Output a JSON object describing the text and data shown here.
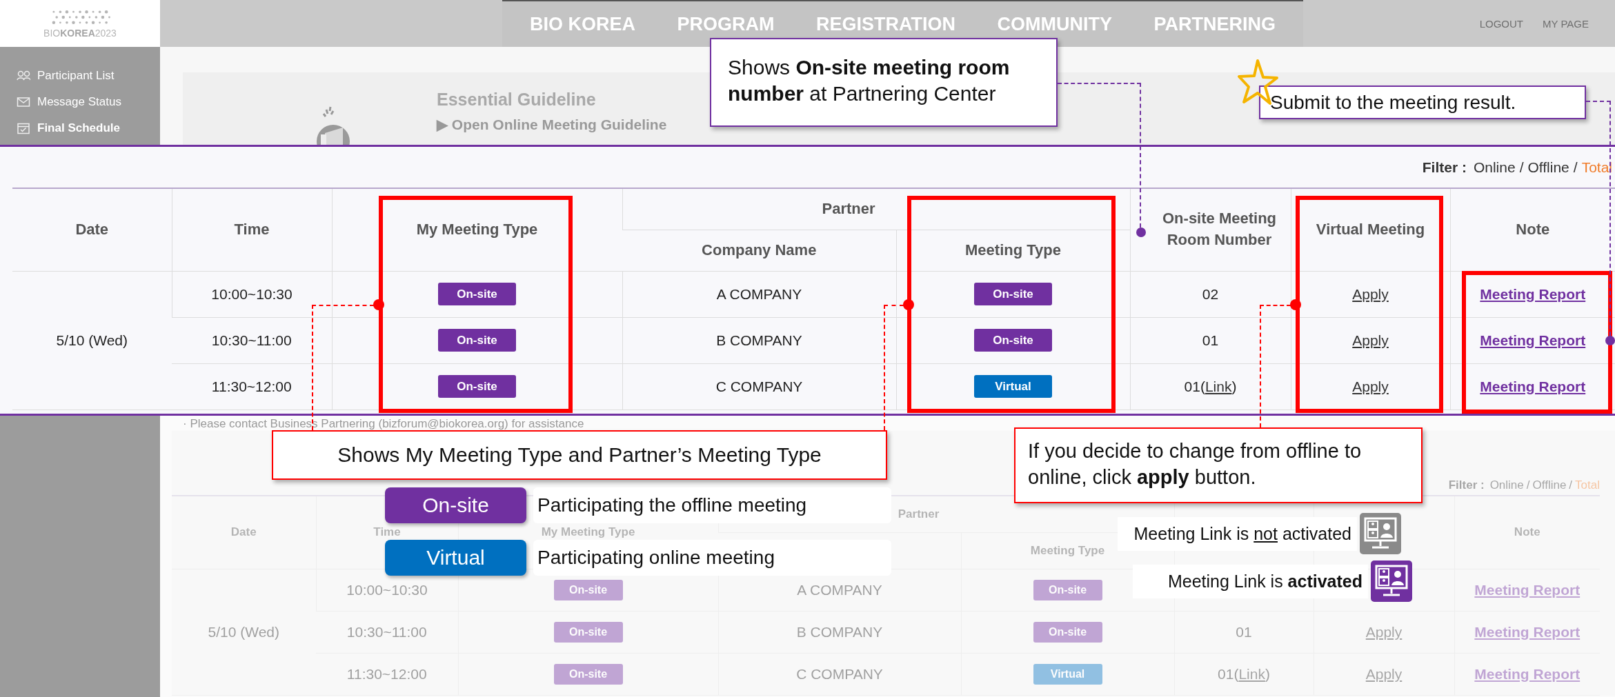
{
  "header": {
    "logo": "BIO**KOREA**2023",
    "nav": [
      "BIO KOREA",
      "PROGRAM",
      "REGISTRATION",
      "COMMUNITY",
      "PARTNERING"
    ],
    "user_links": [
      "LOGOUT",
      "MY PAGE"
    ]
  },
  "sidebar": {
    "items": [
      {
        "label": "Participant List",
        "selected": false
      },
      {
        "label": "Message Status",
        "selected": false
      },
      {
        "label": "Final Schedule",
        "selected": true
      }
    ]
  },
  "guideline": {
    "title": "Essential Guideline",
    "link": "▶ Open Online Meeting Guideline"
  },
  "schedule": {
    "filter": {
      "label": "Filter :",
      "separator": "/",
      "options": [
        {
          "label": "Online",
          "selected": false
        },
        {
          "label": "Offline",
          "selected": false
        },
        {
          "label": "Total",
          "selected": true
        }
      ]
    },
    "columns": {
      "date": "Date",
      "time": "Time",
      "my_type": "My Meeting Type",
      "partner": "Partner",
      "company": "Company Name",
      "partner_type": "Meeting Type",
      "room": "On-site Meeting Room Number",
      "virtual": "Virtual Meeting",
      "note": "Note"
    },
    "date": "5/10 (Wed)",
    "rows": [
      {
        "time": "10:00~10:30",
        "my_type": {
          "kind": "onsite",
          "label": "On-site"
        },
        "company": "A COMPANY",
        "partner_type": {
          "kind": "onsite",
          "label": "On-site"
        },
        "room": "02",
        "virtual": "Apply",
        "note": "Meeting Report"
      },
      {
        "time": "10:30~11:00",
        "my_type": {
          "kind": "onsite",
          "label": "On-site"
        },
        "company": "B COMPANY",
        "partner_type": {
          "kind": "onsite",
          "label": "On-site"
        },
        "room": "01",
        "virtual": "Apply",
        "note": "Meeting Report"
      },
      {
        "time": "11:30~12:00",
        "my_type": {
          "kind": "onsite",
          "label": "On-site"
        },
        "company": "C COMPANY",
        "partner_type": {
          "kind": "virtual",
          "label": "Virtual"
        },
        "room": "01(",
        "room_link": "Link",
        "room_after": ")",
        "virtual": "Apply",
        "note": "Meeting Report"
      }
    ]
  },
  "contact_note": "· Please contact Business Partnering (bizforum@biokorea.org) for assistance",
  "preview": {
    "filter": {
      "label": "Filter :",
      "separator": "/",
      "options": [
        {
          "label": "Online",
          "selected": false
        },
        {
          "label": "Offline",
          "selected": false
        },
        {
          "label": "Total",
          "selected": true
        }
      ]
    },
    "columns": {
      "date": "Date",
      "time": "Time",
      "my_type": "My Meeting Type",
      "partner": "Partner",
      "partner_type": "Meeting Type",
      "note": "Note"
    },
    "date": "5/10 (Wed)",
    "rows": [
      {
        "time": "10:00~10:30",
        "my_type": {
          "kind": "onsite",
          "label": "On-site"
        },
        "company": "A COMPANY",
        "partner_type": {
          "kind": "onsite",
          "label": "On-site"
        },
        "note": "Meeting Report"
      },
      {
        "time": "10:30~11:00",
        "my_type": {
          "kind": "onsite",
          "label": "On-site"
        },
        "company": "B COMPANY",
        "partner_type": {
          "kind": "onsite",
          "label": "On-site"
        },
        "room": "01",
        "virtual": "Apply",
        "note": "Meeting Report"
      },
      {
        "time": "11:30~12:00",
        "my_type": {
          "kind": "onsite",
          "label": "On-site"
        },
        "company": "C COMPANY",
        "partner_type": {
          "kind": "virtual",
          "label": "Virtual"
        },
        "room": "01(",
        "room_link": "Link",
        "room_after": ")",
        "virtual": "Apply",
        "note": "Meeting Report"
      }
    ]
  },
  "callouts": [
    {
      "kind": "purple",
      "text": "Shows **On-site meeting room number** at Partnering Center"
    },
    {
      "kind": "purple",
      "text": "Submit to the meeting result."
    },
    {
      "kind": "red",
      "text": "Shows My Meeting Type and Partner’s Meeting Type"
    },
    {
      "kind": "red",
      "text": "If you decide to change from offline to online, click **apply** button."
    }
  ],
  "legend": [
    {
      "kind": "onsite",
      "label": "On-site",
      "text": "Participating the offline meeting"
    },
    {
      "kind": "virtual",
      "label": "Virtual",
      "text": "Participating online meeting"
    }
  ],
  "link_states": [
    {
      "active": false,
      "text": "Meeting Link is ",
      "highlight": "not",
      "text_after": " activated"
    },
    {
      "active": true,
      "text": "Meeting Link is ",
      "highlight": "activated"
    }
  ]
}
